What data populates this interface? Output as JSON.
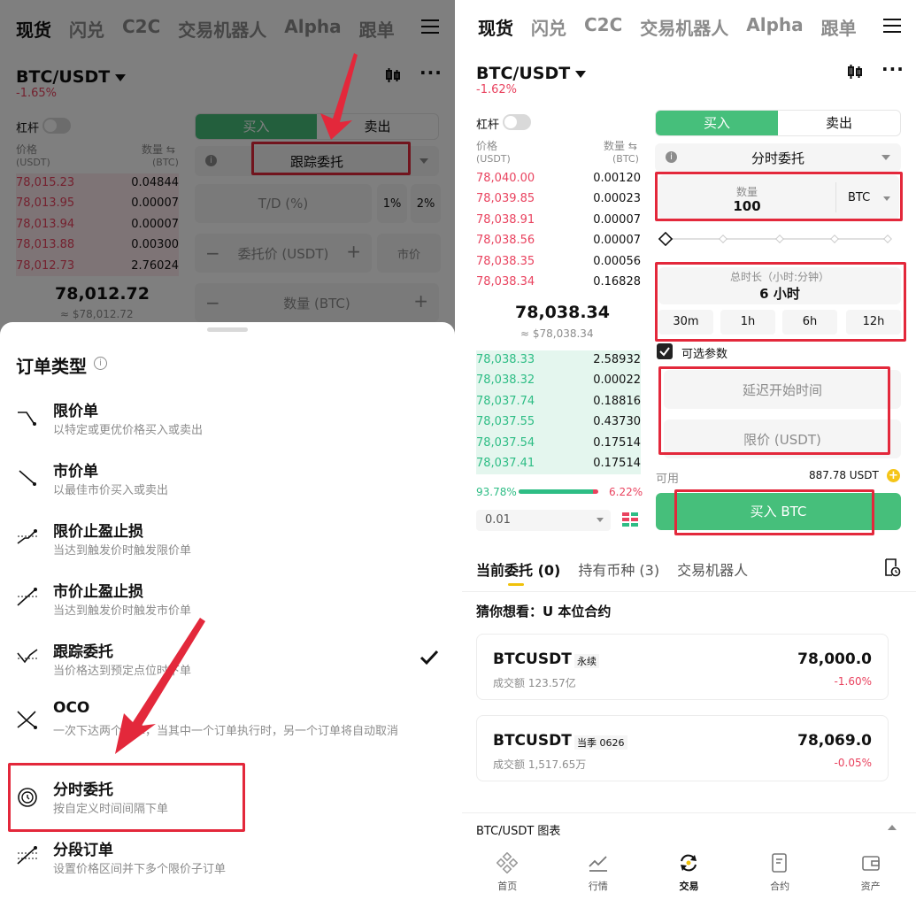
{
  "nav": {
    "spot": "现货",
    "flash": "闪兑",
    "c2c": "C2C",
    "bot": "交易机器人",
    "alpha": "Alpha",
    "copy": "跟单"
  },
  "left": {
    "pair": "BTC/USDT",
    "change": "-1.65%",
    "leverage": "杠杆",
    "col_price": "价格",
    "col_price_unit": "(USDT)",
    "col_qty": "数量 ⇆",
    "col_qty_unit": "(BTC)",
    "asks": [
      {
        "price": "78,015.23",
        "qty": "0.04844"
      },
      {
        "price": "78,013.95",
        "qty": "0.00007"
      },
      {
        "price": "78,013.94",
        "qty": "0.00007"
      },
      {
        "price": "78,013.88",
        "qty": "0.00300"
      },
      {
        "price": "78,012.73",
        "qty": "2.76024"
      }
    ],
    "last_price": "78,012.72",
    "last_price_usd": "≈ $78,012.72",
    "buy": "买入",
    "sell": "卖出",
    "order_type": "跟踪委托",
    "td": "T/D (%)",
    "pct1": "1%",
    "pct2": "2%",
    "order_price": "委托价 (USDT)",
    "market": "市价",
    "qty_btc": "数量 (BTC)",
    "sheet": {
      "title": "订单类型",
      "items": [
        {
          "title": "限价单",
          "desc": "以特定或更优价格买入或卖出"
        },
        {
          "title": "市价单",
          "desc": "以最佳市价买入或卖出"
        },
        {
          "title": "限价止盈止损",
          "desc": "当达到触发价时触发限价单"
        },
        {
          "title": "市价止盈止损",
          "desc": "当达到触发价时触发市价单"
        },
        {
          "title": "跟踪委托",
          "desc": "当价格达到预定点位时下单"
        },
        {
          "title": "OCO",
          "desc": "一次下达两个订单，当其中一个订单执行时，另一个订单将自动取消"
        },
        {
          "title": "分时委托",
          "desc": "按自定义时间间隔下单"
        },
        {
          "title": "分段订单",
          "desc": "设置价格区间并下多个限价子订单"
        }
      ]
    }
  },
  "right": {
    "pair": "BTC/USDT",
    "change": "-1.62%",
    "leverage": "杠杆",
    "col_price": "价格",
    "col_price_unit": "(USDT)",
    "col_qty": "数量 ⇆",
    "col_qty_unit": "(BTC)",
    "asks": [
      {
        "price": "78,040.00",
        "qty": "0.00120"
      },
      {
        "price": "78,039.85",
        "qty": "0.00023"
      },
      {
        "price": "78,038.91",
        "qty": "0.00007"
      },
      {
        "price": "78,038.56",
        "qty": "0.00007"
      },
      {
        "price": "78,038.35",
        "qty": "0.00056"
      },
      {
        "price": "78,038.34",
        "qty": "0.16828"
      }
    ],
    "last_price": "78,038.34",
    "last_price_usd": "≈ $78,038.34",
    "bids": [
      {
        "price": "78,038.33",
        "qty": "2.58932"
      },
      {
        "price": "78,038.32",
        "qty": "0.00022"
      },
      {
        "price": "78,037.74",
        "qty": "0.18816"
      },
      {
        "price": "78,037.55",
        "qty": "0.43730"
      },
      {
        "price": "78,037.54",
        "qty": "0.17514"
      },
      {
        "price": "78,037.41",
        "qty": "0.17514"
      }
    ],
    "bid_pct": "93.78%",
    "ask_pct": "6.22%",
    "bid_ratio": 0.9378,
    "precision": "0.01",
    "buy": "买入",
    "sell": "卖出",
    "order_type": "分时委托",
    "qty_label": "数量",
    "qty_value": "100",
    "qty_unit": "BTC",
    "duration_label": "总时长（小时:分钟）",
    "duration_value": "6 小时",
    "durations": [
      "30m",
      "1h",
      "6h",
      "12h"
    ],
    "optional": "可选参数",
    "delay": "延迟开始时间",
    "limit": "限价 (USDT)",
    "avail_label": "可用",
    "avail_value": "887.78 USDT",
    "buy_btn": "买入 BTC",
    "tabs": [
      "当前委托 (0)",
      "持有币种 (3)",
      "交易机器人"
    ],
    "guess": "猜你想看：U 本位合约",
    "cards": [
      {
        "symbol": "BTCUSDT",
        "tag": "永续",
        "vol": "成交额 123.57亿",
        "price": "78,000.0",
        "chg": "-1.60%"
      },
      {
        "symbol": "BTCUSDT",
        "tag": "当季 0626",
        "vol": "成交额 1,517.65万",
        "price": "78,069.0",
        "chg": "-0.05%"
      }
    ],
    "chart_bar": "BTC/USDT 图表",
    "bottom": [
      "首页",
      "行情",
      "交易",
      "合约",
      "资产"
    ]
  }
}
